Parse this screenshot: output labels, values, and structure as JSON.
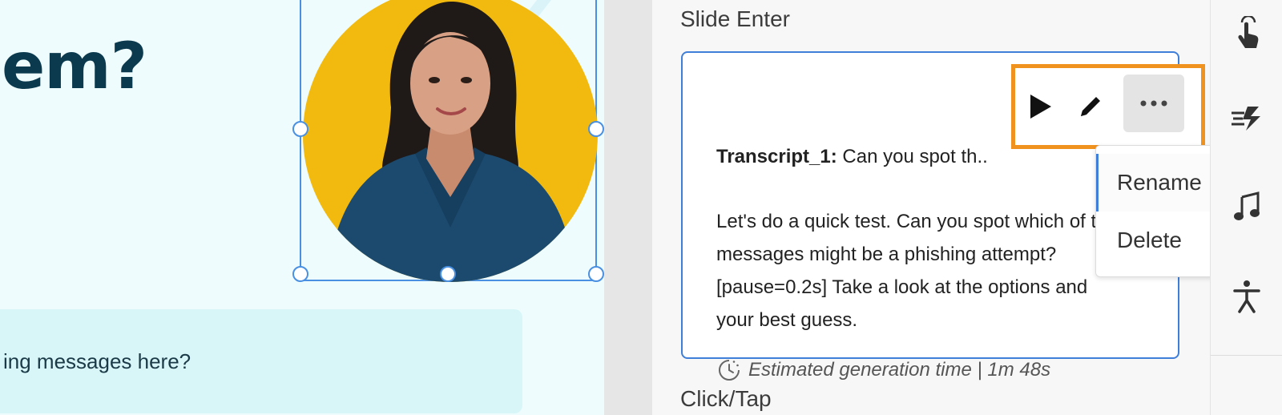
{
  "slide": {
    "heading": "em?",
    "answer_text": "ing messages here?"
  },
  "panel": {
    "section_slide_enter": "Slide Enter",
    "section_click_tap": "Click/Tap",
    "transcript": {
      "name": "Transcript_1:",
      "preview": " Can you spot th..",
      "body_lines": [
        "Let's do a quick test. Can you spot which of t",
        "messages might be a phishing attempt?",
        "[pause=0.2s] Take a look at the options and",
        "your best guess."
      ],
      "estimate_label": "Estimated generation time | 1m 48s"
    },
    "toolbar": {
      "play_icon": "play-icon",
      "edit_icon": "pencil-icon",
      "more_icon": "more-horizontal-icon",
      "highlight_color": "#f0921e"
    },
    "menu": {
      "rename_label": "Rename",
      "delete_label": "Delete"
    }
  },
  "rail": {
    "icons": [
      "touch-icon",
      "fast-animation-icon",
      "music-note-icon",
      "accessibility-icon"
    ]
  },
  "colors": {
    "accent_blue": "#3f7fd9",
    "avatar_bg": "#f2b90f",
    "heading": "#0b3a4e"
  }
}
